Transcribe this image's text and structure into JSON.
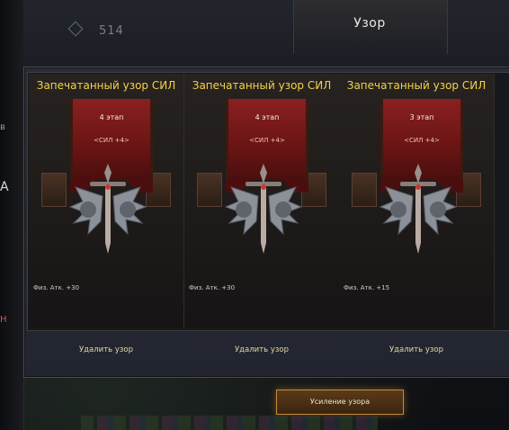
{
  "window": {
    "title": "Узор"
  },
  "topbar": {
    "counter": "514"
  },
  "cards": [
    {
      "name": "Запечатанный узор СИЛ",
      "stage": "4 этап",
      "tag": "<СИЛ +4>",
      "stat": "Физ. Атк. +30",
      "remove_label": "Удалить узор"
    },
    {
      "name": "Запечатанный узор СИЛ",
      "stage": "4 этап",
      "tag": "<СИЛ +4>",
      "stat": "Физ. Атк. +30",
      "remove_label": "Удалить узор"
    },
    {
      "name": "Запечатанный узор СИЛ",
      "stage": "3 этап",
      "tag": "<СИЛ +4>",
      "stat": "Физ. Атк. +15",
      "remove_label": "Удалить узор"
    }
  ],
  "actions": {
    "upgrade_label": "Усиление узора"
  },
  "colors": {
    "card_name": "#f2d24a",
    "banner": "#8a2020",
    "button_border": "#c28b3a"
  },
  "icons": {
    "emblem": "sword-wings-emblem",
    "counter": "diamond-icon"
  }
}
